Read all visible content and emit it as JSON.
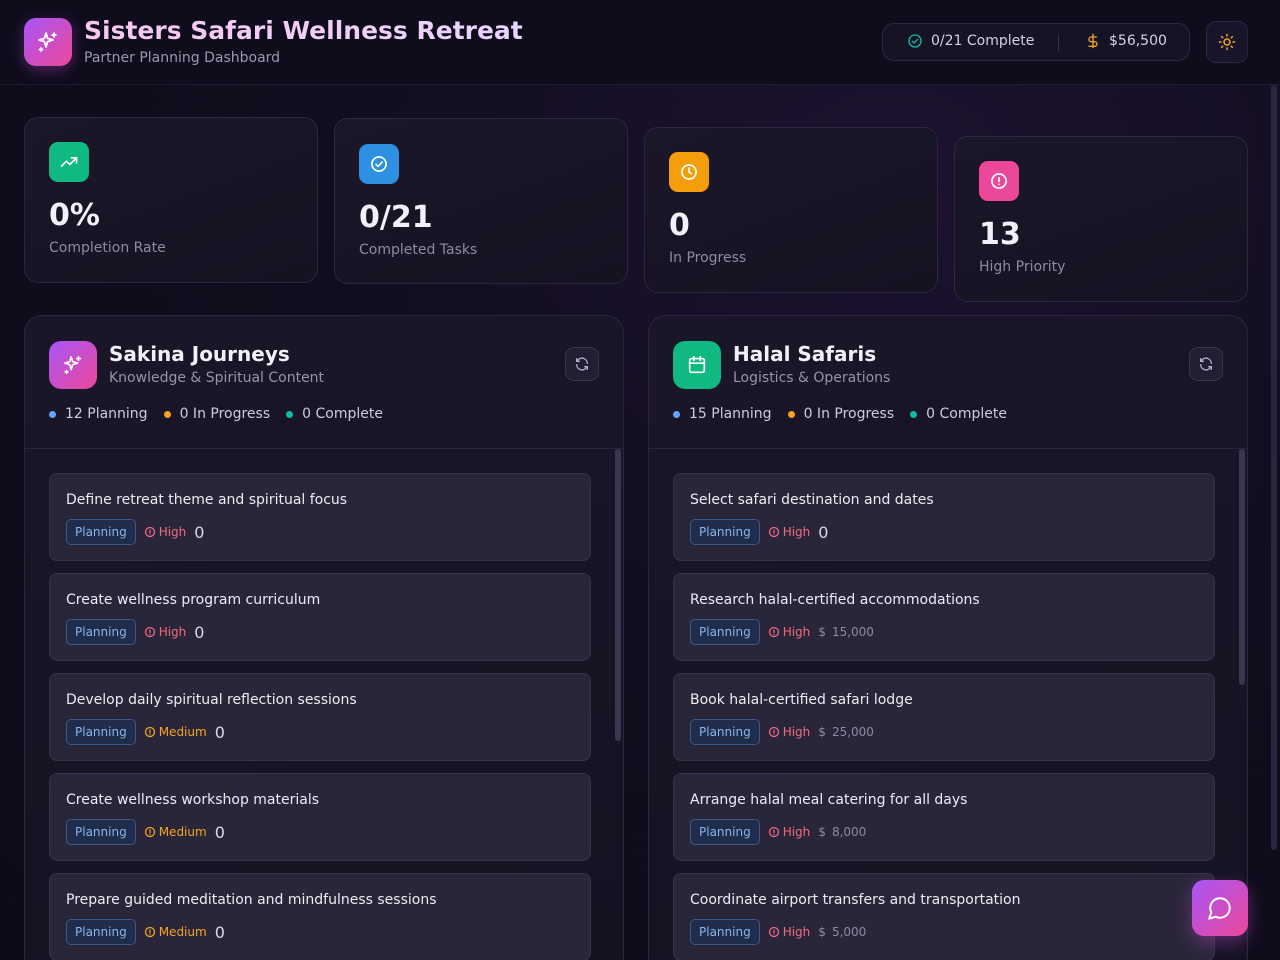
{
  "header": {
    "title": "Sisters Safari Wellness Retreat",
    "subtitle": "Partner Planning Dashboard",
    "complete_summary": "0/21 Complete",
    "budget_total": "$56,500"
  },
  "stats": [
    {
      "value": "0%",
      "label": "Completion Rate",
      "icon": "trending-up-icon",
      "color": "#10b981"
    },
    {
      "value": "0/21",
      "label": "Completed Tasks",
      "icon": "check-circle-icon",
      "color": "#2f8fe0"
    },
    {
      "value": "0",
      "label": "In Progress",
      "icon": "clock-icon",
      "color": "#f59e0b"
    },
    {
      "value": "13",
      "label": "High Priority",
      "icon": "alert-circle-icon",
      "color": "#ec4899"
    }
  ],
  "colors": {
    "accent_gradient_start": "#a855f7",
    "accent_gradient_end": "#ec4899",
    "planning_dot": "#60a5fa",
    "in_progress_dot": "#f5a524",
    "complete_dot": "#14b8a6",
    "high": "#f06b7f",
    "medium": "#f5a524"
  },
  "partners": [
    {
      "name": "Sakina Journeys",
      "role": "Knowledge & Spiritual Content",
      "icon": "sparkles-icon",
      "counts": {
        "planning": "12 Planning",
        "in_progress": "0 In Progress",
        "complete": "0 Complete"
      },
      "tasks": [
        {
          "name": "Define retreat theme and spiritual focus",
          "status": "Planning",
          "priority": "High",
          "cost": "0"
        },
        {
          "name": "Create wellness program curriculum",
          "status": "Planning",
          "priority": "High",
          "cost": "0"
        },
        {
          "name": "Develop daily spiritual reflection sessions",
          "status": "Planning",
          "priority": "Medium",
          "cost": "0"
        },
        {
          "name": "Create wellness workshop materials",
          "status": "Planning",
          "priority": "Medium",
          "cost": "0"
        },
        {
          "name": "Prepare guided meditation and mindfulness sessions",
          "status": "Planning",
          "priority": "Medium",
          "cost": "0"
        }
      ]
    },
    {
      "name": "Halal Safaris",
      "role": "Logistics & Operations",
      "icon": "calendar-icon",
      "counts": {
        "planning": "15 Planning",
        "in_progress": "0 In Progress",
        "complete": "0 Complete"
      },
      "tasks": [
        {
          "name": "Select safari destination and dates",
          "status": "Planning",
          "priority": "High",
          "cost": "0"
        },
        {
          "name": "Research halal-certified accommodations",
          "status": "Planning",
          "priority": "High",
          "cost": "15,000"
        },
        {
          "name": "Book halal-certified safari lodge",
          "status": "Planning",
          "priority": "High",
          "cost": "25,000"
        },
        {
          "name": "Arrange halal meal catering for all days",
          "status": "Planning",
          "priority": "High",
          "cost": "8,000"
        },
        {
          "name": "Coordinate airport transfers and transportation",
          "status": "Planning",
          "priority": "High",
          "cost": "5,000"
        }
      ]
    }
  ]
}
